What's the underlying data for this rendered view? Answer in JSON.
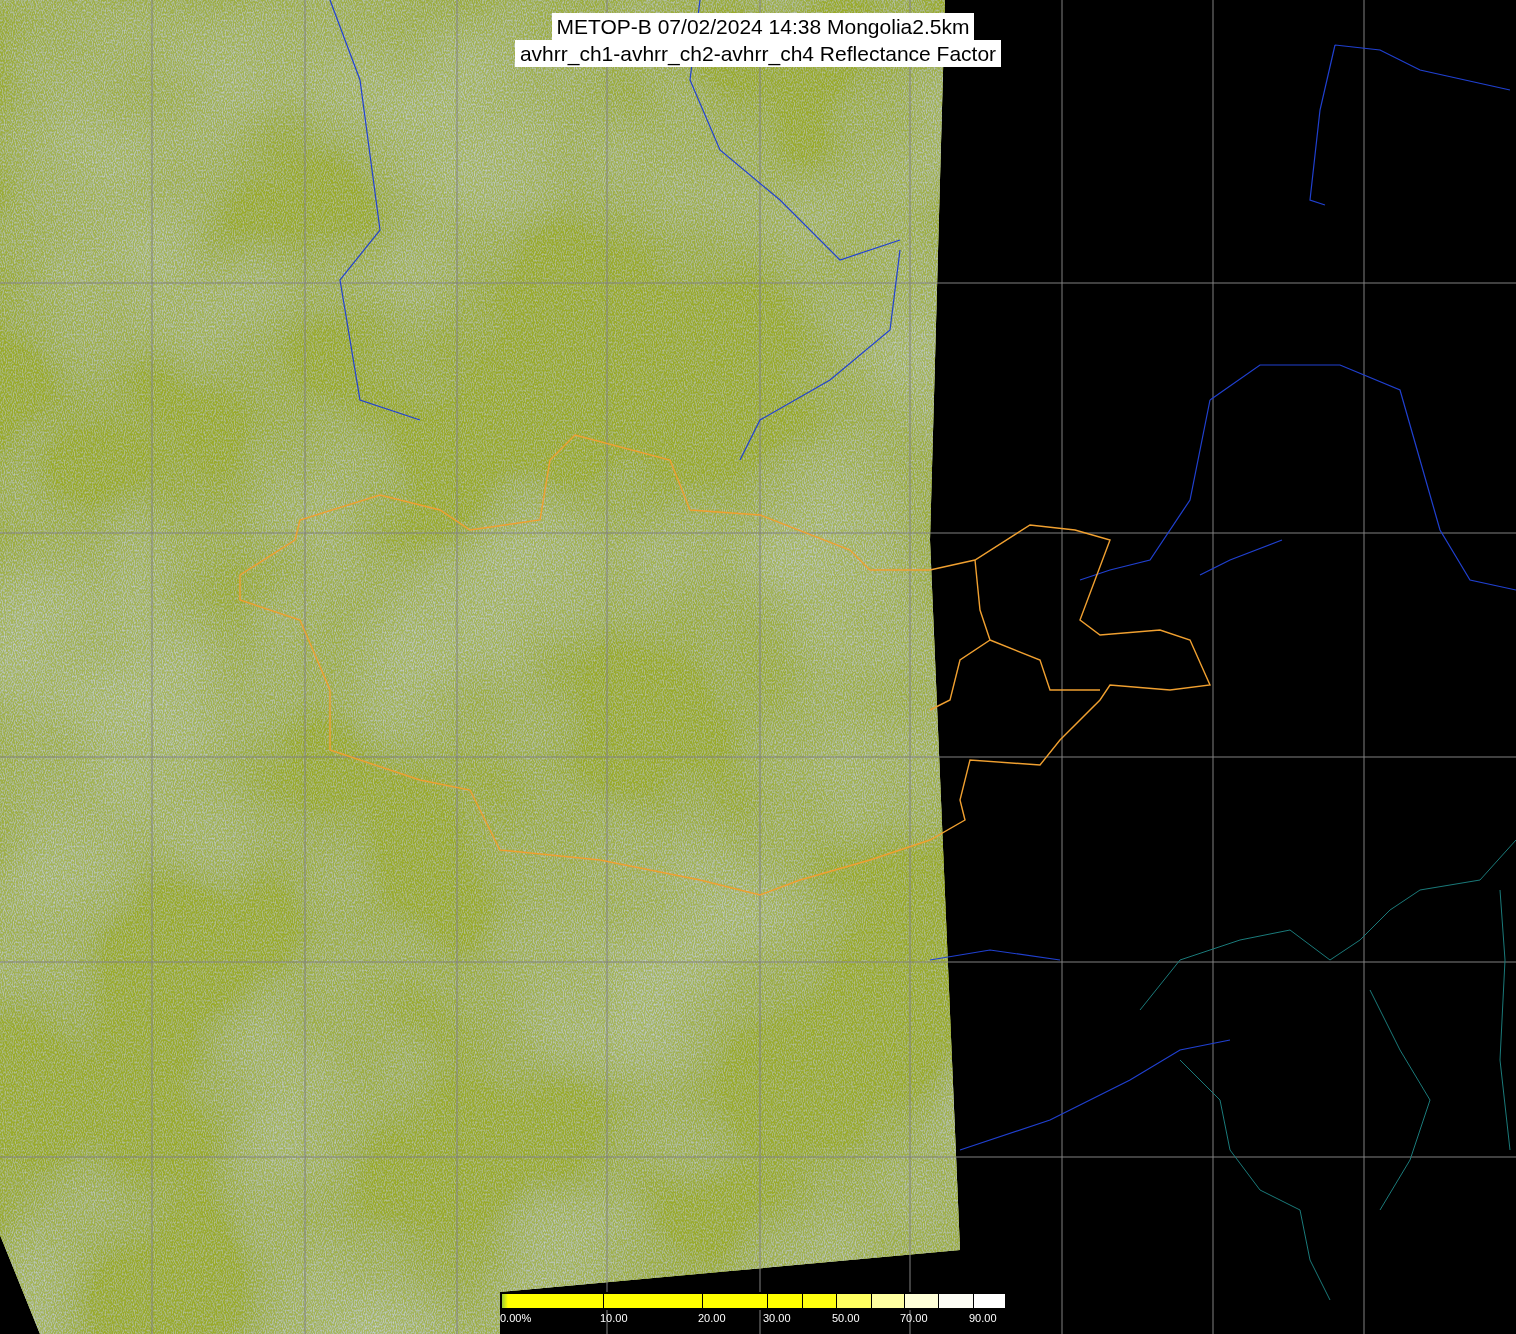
{
  "title": {
    "lines": [
      "METOP-B 07/02/2024 14:38 Mongolia2.5km",
      "avhrr_ch1-avhrr_ch2-avhrr_ch4 Reflectance Factor"
    ]
  },
  "colorbar": {
    "labels": [
      "0.00%",
      "10.00",
      "20.00",
      "30.00",
      "50.00",
      "70.00",
      "90.00"
    ]
  }
}
